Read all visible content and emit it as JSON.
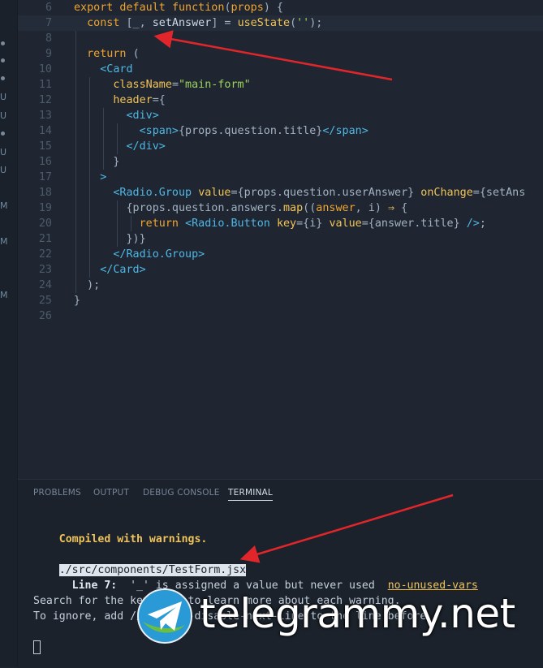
{
  "git_markers": [
    {
      "kind": "dot"
    },
    {
      "kind": "dot"
    },
    {
      "kind": "dot"
    },
    {
      "kind": "text",
      "label": "U"
    },
    {
      "kind": "text",
      "label": "U"
    },
    {
      "kind": "dot"
    },
    {
      "kind": "text",
      "label": "U"
    },
    {
      "kind": "text",
      "label": "U"
    },
    {
      "kind": "text",
      "label": "M"
    },
    {
      "kind": "text",
      "label": "M"
    },
    {
      "kind": "text",
      "label": "M"
    }
  ],
  "editor": {
    "lines": [
      {
        "n": "6",
        "tokens": [
          [
            "kw",
            "export default "
          ],
          [
            "kw",
            "function"
          ],
          [
            "punc",
            "("
          ],
          [
            "kw",
            "props"
          ],
          [
            "punc",
            ") {"
          ]
        ]
      },
      {
        "n": "7",
        "current": true,
        "tokens": [
          [
            "plain",
            "  "
          ],
          [
            "kw",
            "const "
          ],
          [
            "punc",
            "[_, "
          ],
          [
            "plain",
            "setAnswer"
          ],
          [
            "punc",
            "] = "
          ],
          [
            "fn",
            "useState"
          ],
          [
            "punc",
            "("
          ],
          [
            "str",
            "''"
          ],
          [
            "punc",
            ");"
          ]
        ]
      },
      {
        "n": "8",
        "tokens": []
      },
      {
        "n": "9",
        "tokens": [
          [
            "plain",
            "  "
          ],
          [
            "kw",
            "return "
          ],
          [
            "punc",
            "("
          ]
        ]
      },
      {
        "n": "10",
        "tokens": [
          [
            "plain",
            "    "
          ],
          [
            "tag",
            "<Card"
          ]
        ]
      },
      {
        "n": "11",
        "tokens": [
          [
            "plain",
            "      "
          ],
          [
            "attr",
            "className"
          ],
          [
            "punc",
            "="
          ],
          [
            "str",
            "\"main-form\""
          ]
        ]
      },
      {
        "n": "12",
        "tokens": [
          [
            "plain",
            "      "
          ],
          [
            "attr",
            "header"
          ],
          [
            "punc",
            "={"
          ]
        ]
      },
      {
        "n": "13",
        "tokens": [
          [
            "plain",
            "        "
          ],
          [
            "tag",
            "<div>"
          ]
        ]
      },
      {
        "n": "14",
        "tokens": [
          [
            "plain",
            "          "
          ],
          [
            "tag",
            "<span>"
          ],
          [
            "punc",
            "{props.question.title}"
          ],
          [
            "tag",
            "</span>"
          ]
        ]
      },
      {
        "n": "15",
        "tokens": [
          [
            "plain",
            "        "
          ],
          [
            "tag",
            "</div>"
          ]
        ]
      },
      {
        "n": "16",
        "tokens": [
          [
            "plain",
            "      "
          ],
          [
            "punc",
            "}"
          ]
        ]
      },
      {
        "n": "17",
        "tokens": [
          [
            "plain",
            "    "
          ],
          [
            "tag",
            ">"
          ]
        ]
      },
      {
        "n": "18",
        "tokens": [
          [
            "plain",
            "      "
          ],
          [
            "tag",
            "<Radio.Group "
          ],
          [
            "attr",
            "value"
          ],
          [
            "punc",
            "={props.question.userAnswer} "
          ],
          [
            "attr",
            "onChange"
          ],
          [
            "punc",
            "={setAns"
          ]
        ]
      },
      {
        "n": "19",
        "tokens": [
          [
            "plain",
            "        "
          ],
          [
            "punc",
            "{props.question.answers."
          ],
          [
            "fn",
            "map"
          ],
          [
            "punc",
            "(("
          ],
          [
            "kw",
            "answer"
          ],
          [
            "punc",
            ", i) "
          ],
          [
            "op",
            "⇒"
          ],
          [
            "punc",
            " {"
          ]
        ]
      },
      {
        "n": "20",
        "tokens": [
          [
            "plain",
            "          "
          ],
          [
            "kw",
            "return "
          ],
          [
            "tag",
            "<Radio.Button "
          ],
          [
            "attr",
            "key"
          ],
          [
            "punc",
            "={i} "
          ],
          [
            "attr",
            "value"
          ],
          [
            "punc",
            "={answer.title} "
          ],
          [
            "tag",
            "/>"
          ],
          [
            "punc",
            ";"
          ]
        ]
      },
      {
        "n": "21",
        "tokens": [
          [
            "plain",
            "        "
          ],
          [
            "punc",
            "})}"
          ]
        ]
      },
      {
        "n": "22",
        "tokens": [
          [
            "plain",
            "      "
          ],
          [
            "tag",
            "</Radio.Group>"
          ]
        ]
      },
      {
        "n": "23",
        "tokens": [
          [
            "plain",
            "    "
          ],
          [
            "tag",
            "</Card>"
          ]
        ]
      },
      {
        "n": "24",
        "tokens": [
          [
            "plain",
            "  "
          ],
          [
            "punc",
            ");"
          ]
        ]
      },
      {
        "n": "25",
        "tokens": [
          [
            "punc",
            "}"
          ]
        ]
      },
      {
        "n": "26",
        "tokens": []
      }
    ]
  },
  "panel": {
    "tabs": [
      {
        "label": "PROBLEMS"
      },
      {
        "label": "OUTPUT"
      },
      {
        "label": "DEBUG CONSOLE"
      },
      {
        "label": "TERMINAL",
        "active": true
      }
    ],
    "terminal": {
      "compiled": "Compiled with warnings.",
      "file_path": "./src/components/TestForm.jsx",
      "line_label": "Line 7:",
      "message": "  '_' is assigned a value but never used  ",
      "rule": "no-unused-vars",
      "search_hint": "Search for the keywords to learn more about each warning.",
      "ignore_hint": "To ignore, add // eslint-disable-next-line to the line before."
    }
  },
  "watermark": {
    "text": "telegrammy.net"
  }
}
